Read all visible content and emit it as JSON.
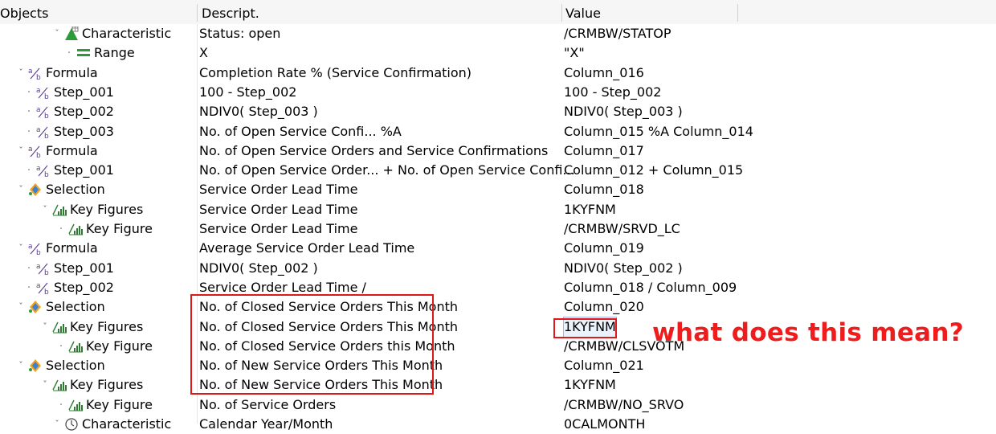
{
  "header": {
    "objects": "Objects",
    "descript": "Descript.",
    "value": "Value"
  },
  "annotation": {
    "text": "what does this mean?",
    "color": "#ee1c1c"
  },
  "rows": [
    {
      "expand": "collapse",
      "indent": 65,
      "icon": "characteristic-icon",
      "obj": "Characteristic",
      "desc": "Status: open",
      "value": "/CRMBW/STATOP"
    },
    {
      "expand": "leaf",
      "indent": 80,
      "icon": "range-icon",
      "obj": "Range",
      "desc": "X",
      "value": "\"X\""
    },
    {
      "expand": "collapse",
      "indent": 20,
      "icon": "formula-icon",
      "obj": "Formula",
      "desc": "Completion Rate % (Service Confirmation)",
      "value": "Column_016"
    },
    {
      "expand": "leaf",
      "indent": 30,
      "icon": "formula-icon",
      "obj": "Step_001",
      "desc": "100 - Step_002",
      "value": "100 - Step_002"
    },
    {
      "expand": "leaf",
      "indent": 30,
      "icon": "formula-icon",
      "obj": "Step_002",
      "desc": "NDIV0( Step_003 )",
      "value": "NDIV0( Step_003 )"
    },
    {
      "expand": "leaf",
      "indent": 30,
      "icon": "formula-icon",
      "obj": "Step_003",
      "desc": "No. of Open Service Confi... %A",
      "value": "Column_015 %A Column_014"
    },
    {
      "expand": "collapse",
      "indent": 20,
      "icon": "formula-icon",
      "obj": "Formula",
      "desc": "No. of Open Service Orders and Service Confirmations",
      "value": "Column_017"
    },
    {
      "expand": "leaf",
      "indent": 30,
      "icon": "formula-icon",
      "obj": "Step_001",
      "desc": "No. of Open Service Order... + No. of Open Service Confi...",
      "value": "Column_012 + Column_015"
    },
    {
      "expand": "collapse",
      "indent": 20,
      "icon": "selection-icon",
      "obj": "Selection",
      "desc": "Service Order Lead Time",
      "value": "Column_018"
    },
    {
      "expand": "collapse",
      "indent": 50,
      "icon": "key-figure-icon",
      "obj": "Key Figures",
      "desc": "Service Order Lead Time",
      "value": "1KYFNM"
    },
    {
      "expand": "leaf",
      "indent": 70,
      "icon": "key-figure-icon",
      "obj": "Key Figure",
      "desc": "Service Order Lead Time",
      "value": "/CRMBW/SRVD_LC"
    },
    {
      "expand": "collapse",
      "indent": 20,
      "icon": "formula-icon",
      "obj": "Formula",
      "desc": "Average Service Order Lead Time",
      "value": "Column_019"
    },
    {
      "expand": "leaf",
      "indent": 30,
      "icon": "formula-icon",
      "obj": "Step_001",
      "desc": "NDIV0( Step_002 )",
      "value": "NDIV0( Step_002 )"
    },
    {
      "expand": "leaf",
      "indent": 30,
      "icon": "formula-icon",
      "obj": "Step_002",
      "desc": "Service Order Lead Time /",
      "value": "Column_018 / Column_009"
    },
    {
      "expand": "collapse",
      "indent": 20,
      "icon": "selection-icon",
      "obj": "Selection",
      "desc": "No. of Closed Service Orders This Month",
      "value": "Column_020"
    },
    {
      "expand": "collapse",
      "indent": 50,
      "icon": "key-figure-icon",
      "obj": "Key Figures",
      "desc": "No. of Closed Service Orders This Month",
      "value": "1KYFNM"
    },
    {
      "expand": "leaf",
      "indent": 70,
      "icon": "key-figure-icon",
      "obj": "Key Figure",
      "desc": "No. of Closed Service Orders this Month",
      "value": "/CRMBW/CLSVOTM"
    },
    {
      "expand": "collapse",
      "indent": 20,
      "icon": "selection-icon",
      "obj": "Selection",
      "desc": "No. of New Service Orders This Month",
      "value": "Column_021"
    },
    {
      "expand": "collapse",
      "indent": 50,
      "icon": "key-figure-icon",
      "obj": "Key Figures",
      "desc": "No. of New Service Orders This Month",
      "value": "1KYFNM"
    },
    {
      "expand": "leaf",
      "indent": 70,
      "icon": "key-figure-icon",
      "obj": "Key Figure",
      "desc": "No. of Service Orders",
      "value": "/CRMBW/NO_SRVO"
    },
    {
      "expand": "collapse",
      "indent": 65,
      "icon": "characteristic-clock-icon",
      "obj": "Characteristic",
      "desc": "Calendar Year/Month",
      "value": "0CALMONTH"
    }
  ]
}
